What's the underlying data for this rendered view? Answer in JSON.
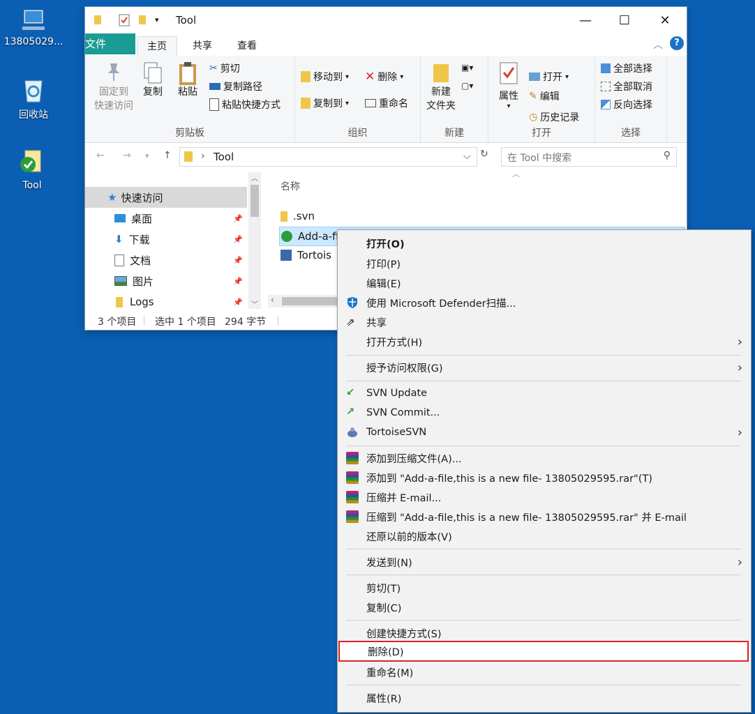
{
  "desktop": {
    "icons": [
      {
        "label": "13805029...",
        "icon": "computer-icon"
      },
      {
        "label": "回收站",
        "icon": "recycle-bin-icon"
      },
      {
        "label": "Tool",
        "icon": "folder-svn-icon"
      }
    ]
  },
  "window": {
    "title": "Tool",
    "tabs": [
      {
        "label": "文件"
      },
      {
        "label": "主页"
      },
      {
        "label": "共享"
      },
      {
        "label": "查看"
      }
    ],
    "ribbon": {
      "clipboard": {
        "label": "剪贴板",
        "pin_line1": "固定到",
        "pin_line2": "快速访问",
        "copy": "复制",
        "paste": "粘贴",
        "cut": "剪切",
        "copy_path": "复制路径",
        "paste_shortcut": "粘贴快捷方式"
      },
      "organize": {
        "label": "组织",
        "move_to": "移动到",
        "copy_to": "复制到",
        "delete": "删除",
        "rename": "重命名"
      },
      "new": {
        "label": "新建",
        "new_folder_line1": "新建",
        "new_folder_line2": "文件夹"
      },
      "open": {
        "label": "打开",
        "properties": "属性",
        "open": "打开",
        "edit": "编辑",
        "history": "历史记录"
      },
      "select": {
        "label": "选择",
        "select_all": "全部选择",
        "select_none": "全部取消",
        "invert": "反向选择"
      }
    },
    "address": {
      "path": "Tool",
      "search_placeholder": "在 Tool 中搜索"
    },
    "nav": [
      {
        "label": "快速访问"
      },
      {
        "label": "桌面"
      },
      {
        "label": "下载"
      },
      {
        "label": "文档"
      },
      {
        "label": "图片"
      },
      {
        "label": "Logs"
      }
    ],
    "content": {
      "column_name": "名称",
      "files": [
        {
          "name": ".svn"
        },
        {
          "name": "Add-a-file,this is a new file- 13805029595.txt"
        },
        {
          "name": "Tortois"
        }
      ]
    },
    "status": {
      "count": "3 个项目",
      "selected": "选中 1 个项目",
      "size": "294 字节"
    }
  },
  "context_menu": {
    "items": [
      {
        "label": "打开(O)"
      },
      {
        "label": "打印(P)"
      },
      {
        "label": "编辑(E)"
      },
      {
        "label": "使用 Microsoft Defender扫描..."
      },
      {
        "label": "共享"
      },
      {
        "label": "打开方式(H)"
      },
      {
        "label": "授予访问权限(G)"
      },
      {
        "label": "SVN Update"
      },
      {
        "label": "SVN Commit..."
      },
      {
        "label": "TortoiseSVN"
      },
      {
        "label": "添加到压缩文件(A)..."
      },
      {
        "label": "添加到 \"Add-a-file,this is a new file- 13805029595.rar\"(T)"
      },
      {
        "label": "压缩并 E-mail..."
      },
      {
        "label": "压缩到 \"Add-a-file,this is a new file- 13805029595.rar\" 并 E-mail"
      },
      {
        "label": "还原以前的版本(V)"
      },
      {
        "label": "发送到(N)"
      },
      {
        "label": "剪切(T)"
      },
      {
        "label": "复制(C)"
      },
      {
        "label": "创建快捷方式(S)"
      },
      {
        "label": "删除(D)"
      },
      {
        "label": "重命名(M)"
      },
      {
        "label": "属性(R)"
      }
    ]
  },
  "colors": {
    "desktop": "#0a5fb4",
    "file_tab": "#1a9b94",
    "highlight_border": "#d8232a"
  }
}
